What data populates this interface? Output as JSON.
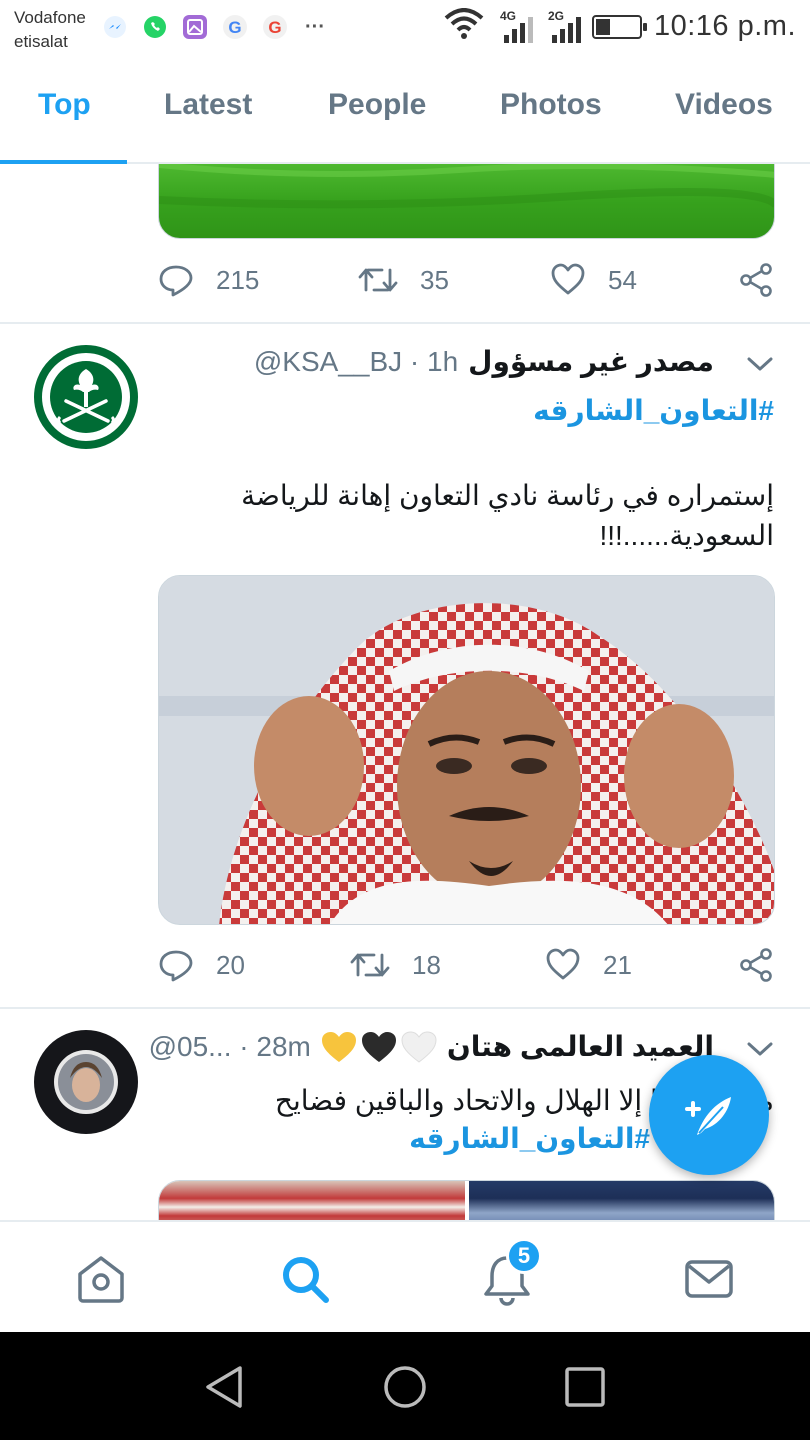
{
  "status_bar": {
    "carrier_line1": "Vodafone",
    "carrier_line2": "etisalat",
    "icons": [
      "messenger-icon",
      "whatsapp-icon",
      "gallery-icon",
      "google-icon",
      "google-icon",
      "more-icon"
    ],
    "more": "···",
    "net1": "4G",
    "net2": "2G",
    "battery_level": 0.35,
    "time": "10:16 p.m."
  },
  "tabs": [
    {
      "label": "Top",
      "active": true
    },
    {
      "label": "Latest"
    },
    {
      "label": "People"
    },
    {
      "label": "Photos"
    },
    {
      "label": "Videos"
    }
  ],
  "tweets": [
    {
      "replies": "215",
      "retweets": "35",
      "likes": "54",
      "media": "green-field-image"
    },
    {
      "username": "مصدر غير مسؤول",
      "handle": "@KSA__BJ · 1h",
      "hashtag": "#التعاون_الشارقه",
      "text": "إستمراره في رئاسة نادي التعاون إهانة للرياضة السعودية......!!!",
      "media": "man-in-red-shemagh-photo",
      "replies": "20",
      "retweets": "18",
      "likes": "21"
    },
    {
      "emoji": [
        "yellow-heart",
        "black-heart",
        "white-heart"
      ],
      "username": "العميد العالمى هتان",
      "handle": "@05... · 28m",
      "text_line1": "ما في اسيا إلا الهلال والاتحاد والباقين فضايح",
      "hashtag": "#التعاون_الشارقه"
    }
  ],
  "fab": {
    "label": "compose-tweet"
  },
  "bottom_nav": {
    "items": [
      "home-icon",
      "search-icon",
      "notifications-icon",
      "messages-icon"
    ],
    "notification_count": "5"
  },
  "system_nav": [
    "back-icon",
    "home-circle-icon",
    "recents-icon"
  ],
  "colors": {
    "accent": "#1da1f2",
    "text": "#14171a",
    "secondary": "#657786",
    "divider": "#e6ecf0",
    "saudi_green": "#006c35"
  }
}
